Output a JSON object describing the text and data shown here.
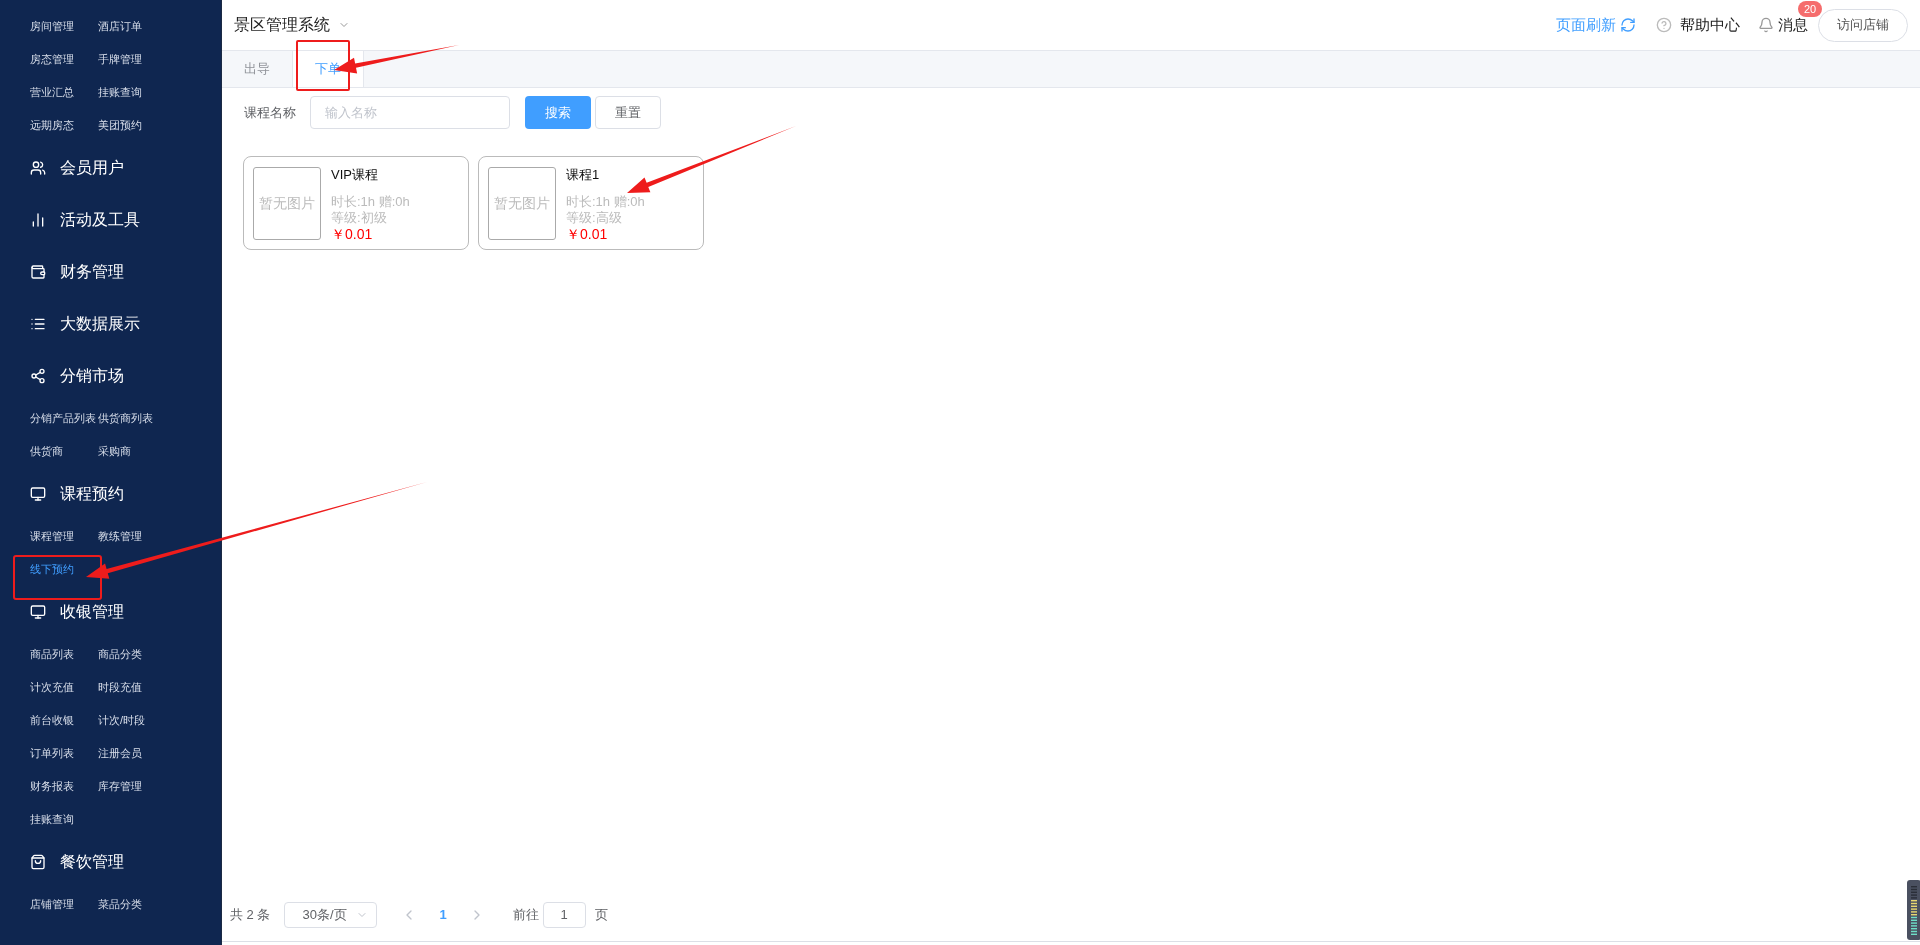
{
  "sidebar": {
    "sections": [
      {
        "items": [
          {
            "label": "房间管理",
            "selected": false
          },
          {
            "label": "酒店订单",
            "selected": false
          },
          {
            "label": "房态管理",
            "selected": false
          },
          {
            "label": "手牌管理",
            "selected": false
          },
          {
            "label": "营业汇总",
            "selected": false
          },
          {
            "label": "挂账查询",
            "selected": false
          },
          {
            "label": "远期房态",
            "selected": false
          },
          {
            "label": "美团预约",
            "selected": false
          }
        ]
      },
      {
        "title": "会员用户",
        "kind": "users"
      },
      {
        "title": "活动及工具",
        "kind": "chart"
      },
      {
        "title": "财务管理",
        "kind": "wallet"
      },
      {
        "title": "大数据展示",
        "kind": "list"
      },
      {
        "title": "分销市场",
        "kind": "share",
        "items": [
          {
            "label": "分销产品列表",
            "selected": false
          },
          {
            "label": "供货商列表",
            "selected": false
          },
          {
            "label": "供货商",
            "selected": false
          },
          {
            "label": "采购商",
            "selected": false
          }
        ]
      },
      {
        "title": "课程预约",
        "kind": "register",
        "items": [
          {
            "label": "课程管理",
            "selected": false
          },
          {
            "label": "教练管理",
            "selected": false
          },
          {
            "label": "线下预约",
            "selected": true
          }
        ]
      },
      {
        "title": "收银管理",
        "kind": "register",
        "items": [
          {
            "label": "商品列表",
            "selected": false
          },
          {
            "label": "商品分类",
            "selected": false
          },
          {
            "label": "计次充值",
            "selected": false
          },
          {
            "label": "时段充值",
            "selected": false
          },
          {
            "label": "前台收银",
            "selected": false
          },
          {
            "label": "计次/时段",
            "selected": false
          },
          {
            "label": "订单列表",
            "selected": false
          },
          {
            "label": "注册会员",
            "selected": false
          },
          {
            "label": "财务报表",
            "selected": false
          },
          {
            "label": "库存管理",
            "selected": false
          },
          {
            "label": "挂账查询",
            "selected": false
          }
        ]
      },
      {
        "title": "餐饮管理",
        "kind": "bag",
        "items": [
          {
            "label": "店铺管理",
            "selected": false
          },
          {
            "label": "菜品分类",
            "selected": false
          }
        ]
      }
    ]
  },
  "header": {
    "title": "景区管理系统",
    "refresh": "页面刷新",
    "help": "帮助中心",
    "messages": "消息",
    "badge": "20",
    "visit_button": "访问店铺"
  },
  "tabs": [
    {
      "label": "出导",
      "selected": false
    },
    {
      "label": "下单",
      "selected": true
    }
  ],
  "search": {
    "label": "课程名称",
    "placeholder": "输入名称",
    "search_button": "搜索",
    "reset_button": "重置"
  },
  "courses": [
    {
      "image": "暂无图片",
      "name": "VIP课程",
      "duration": "时长:1h 赠:0h",
      "level": "等级:初级",
      "price": "￥0.01"
    },
    {
      "image": "暂无图片",
      "name": "课程1",
      "duration": "时长:1h 赠:0h",
      "level": "等级:高级",
      "price": "￥0.01"
    }
  ],
  "pagination": {
    "total": "共 2 条",
    "page_size": "30条/页",
    "pages": [
      {
        "label": "1",
        "selected": true
      }
    ],
    "goto_label": "前往",
    "goto_value": "1",
    "goto_suffix": "页"
  }
}
